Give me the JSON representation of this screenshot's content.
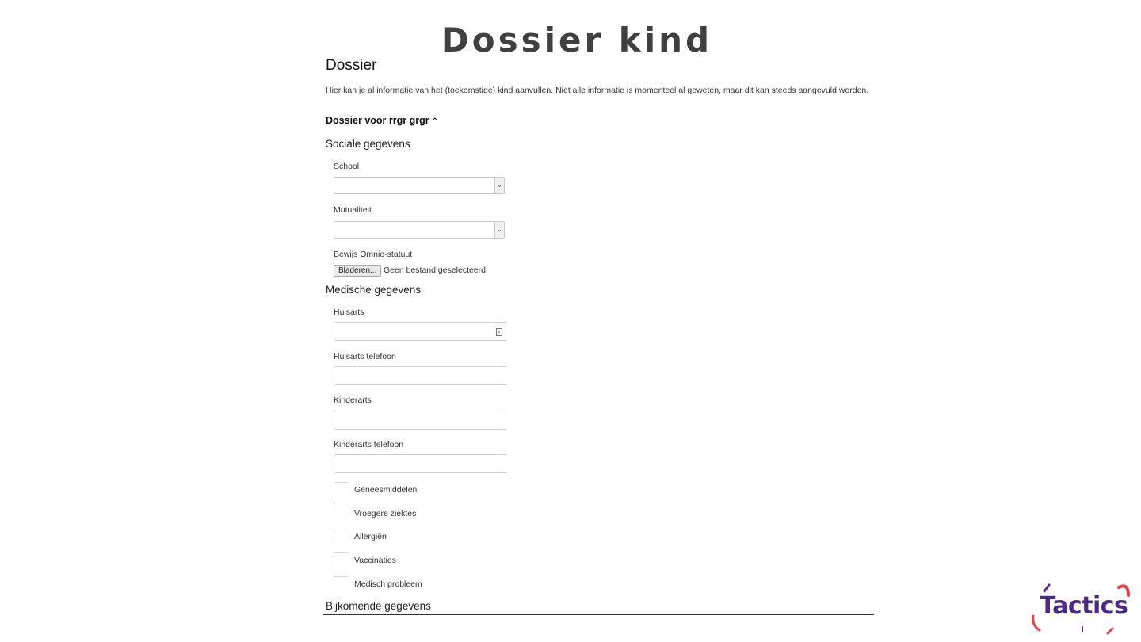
{
  "slide": {
    "title": "Dossier kind"
  },
  "page": {
    "heading": "Dossier",
    "intro": "Hier kan je al informatie van het (toekomstige) kind aanvullen. Niet alle informatie is momenteel al geweten, maar dit kan steeds aangevuld worden."
  },
  "dossier": {
    "toggle_label": "Dossier voor rrgr grgr",
    "toggle_icon": "chevron-up-icon"
  },
  "sociale": {
    "title": "Sociale gegevens",
    "school_label": "School",
    "school_value": "",
    "mutualiteit_label": "Mutualiteit",
    "mutualiteit_value": "",
    "omnio_label": "Bewijs Omnio-statuut",
    "file_button": "Bladeren...",
    "file_status": "Geen bestand geselecteerd."
  },
  "medische": {
    "title": "Medische gegevens",
    "huisarts_label": "Huisarts",
    "huisarts_tel_label": "Huisarts telefoon",
    "kinderarts_label": "Kinderarts",
    "kinderarts_tel_label": "Kinderarts telefoon",
    "checkboxes": [
      "Geneesmiddelen",
      "Vroegere ziektes",
      "Allergiën",
      "Vaccinaties",
      "Medisch probleem"
    ]
  },
  "bijkomende": {
    "title": "Bijkomende gegevens"
  },
  "logo": {
    "text": "Tactics",
    "colors": {
      "text": "#4b2a86",
      "accent_red": "#e8404a",
      "accent_purple": "#5a2d91"
    }
  }
}
